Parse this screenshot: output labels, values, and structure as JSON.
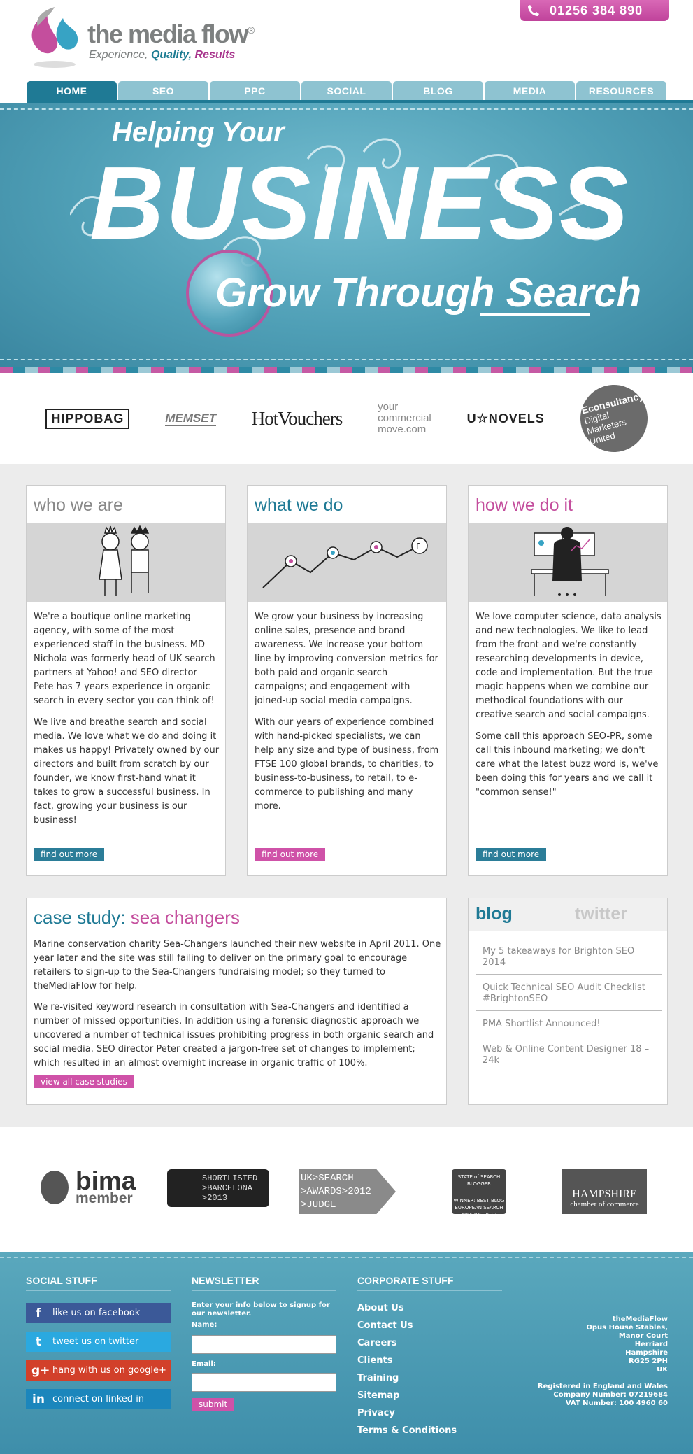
{
  "header": {
    "logo_name": "the media flow",
    "logo_reg": "®",
    "tagline_a": "Experience,",
    "tagline_b": "Quality,",
    "tagline_c": "Results",
    "phone": "01256 384 890"
  },
  "nav": {
    "tabs": [
      "HOME",
      "SEO",
      "PPC",
      "SOCIAL",
      "BLOG",
      "MEDIA",
      "RESOURCES"
    ],
    "active": "HOME"
  },
  "hero": {
    "line1": "Helping Your",
    "line2": "BUSINESS",
    "line3": "Grow Through Search"
  },
  "clients": {
    "hippobag": "HIPPOBAG",
    "memset": "MEMSET",
    "hotvouchers": "HotVouchers",
    "move_a": "your",
    "move_b": "commercial",
    "move_c": "move.com",
    "novels": "U☆NOVELS",
    "econ_a": "Econsultancy",
    "econ_b": "Digital",
    "econ_c": "Marketers",
    "econ_d": "United"
  },
  "cards": [
    {
      "title": "who we are",
      "p1": "We're a boutique online marketing agency, with some of the most experienced staff in the business. MD Nichola was formerly head of UK search partners at Yahoo! and SEO director Pete has 7 years experience in organic search in every sector you can think of!",
      "p2": "We live and breathe search and social media. We love what we do and doing it makes us happy! Privately owned by our directors and built from scratch by our founder, we know first-hand what it takes to grow a successful business. In fact, growing your business is our business!",
      "button": "find out more"
    },
    {
      "title": "what we do",
      "p1": "We grow your business by increasing online sales, presence and brand awareness. We increase your bottom line by improving conversion metrics for both paid and organic search campaigns; and engagement with joined-up social media campaigns.",
      "p2": "With our years of experience combined with hand-picked specialists, we can help any size and type of business, from FTSE 100 global brands, to charities, to business-to-business, to retail, to e-commerce to publishing and many more.",
      "button": "find out more"
    },
    {
      "title": "how we do it",
      "p1": "We love computer science, data analysis and new technologies. We like to lead from the front and we're constantly researching developments in device, code and implementation. But the true magic happens when we combine our methodical foundations with our creative search and social campaigns.",
      "p2": "Some call this approach SEO-PR, some call this inbound marketing; we don't care what the latest buzz word is, we've been doing this for years and we call it \"common sense!\"",
      "button": "find out more"
    }
  ],
  "case_study": {
    "label": "case study:",
    "name": "sea changers",
    "p1": "Marine conservation charity Sea-Changers launched their new website in April 2011. One year later and the site was still failing to deliver on the primary goal to encourage retailers to sign-up to the Sea-Changers fundraising model; so they turned to theMediaFlow for help.",
    "p2": "We re-visited keyword research in consultation with Sea-Changers and identified a number of missed opportunities. In addition using a forensic diagnostic approach we uncovered a number of technical issues prohibiting progress in both organic search and social media. SEO director Peter created a jargon-free set of changes to implement; which resulted in an almost overnight increase in organic traffic of 100%.",
    "button": "view all case studies"
  },
  "blog": {
    "tab_blog": "blog",
    "tab_twitter": "twitter",
    "items": [
      "My 5 takeaways for Brighton SEO 2014",
      "Quick Technical SEO Audit Checklist #BrightonSEO",
      "PMA Shortlist Announced!",
      "Web & Online Content Designer 18 – 24k"
    ]
  },
  "awards": {
    "bima": "bima",
    "bima_sub": "member",
    "short_a": "SHORTLISTED",
    "short_b": ">BARCELONA",
    "short_c": ">2013",
    "judge_a": "UK>SEARCH",
    "judge_b": ">AWARDS>2012",
    "judge_c": ">JUDGE",
    "blog_a": "STATE of SEARCH",
    "blog_b": "BLOGGER",
    "blog_c": "WINNER: BEST BLOG",
    "blog_d": "EUROPEAN SEARCH AWARDS 2012",
    "hants": "HAMPSHIRE",
    "hants_sub": "chamber of commerce"
  },
  "footer": {
    "social_head": "SOCIAL STUFF",
    "social": [
      {
        "label": "like us on facebook",
        "icon": "f",
        "color": "#3b5998"
      },
      {
        "label": "tweet us on twitter",
        "icon": "t",
        "color": "#2aa9e0"
      },
      {
        "label": "hang with us on google+",
        "icon": "g+",
        "color": "#d2402a"
      },
      {
        "label": "connect on linked in",
        "icon": "in",
        "color": "#1b86bc"
      }
    ],
    "newsletter_head": "NEWSLETTER",
    "newsletter_intro": "Enter your info below to signup for our newsletter.",
    "name_label": "Name:",
    "email_label": "Email:",
    "submit": "submit",
    "corporate_head": "CORPORATE STUFF",
    "corporate": [
      "About Us",
      "Contact Us",
      "Careers",
      "Clients",
      "Training",
      "Sitemap",
      "Privacy",
      "Terms & Conditions"
    ],
    "address": [
      "theMediaFlow",
      "Opus House Stables,",
      "Manor Court",
      "Herriard",
      "Hampshire",
      "RG25 2PH",
      "UK"
    ],
    "registered": [
      "Registered in England and Wales",
      "Company Number: 07219684",
      "VAT Number: 100 4960 60"
    ]
  }
}
